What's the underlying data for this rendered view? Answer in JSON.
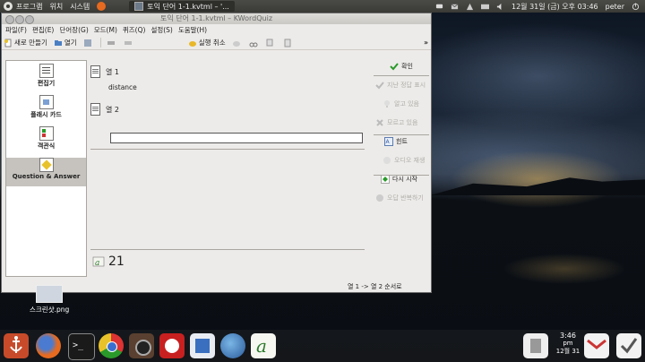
{
  "top_panel": {
    "menus": [
      "프로그램",
      "위치",
      "시스템"
    ],
    "task_title": "토익 단어 1-1.kvtml – '...",
    "clock": "12월 31일 (금) 오후 03:46",
    "user": "peter"
  },
  "window": {
    "title": "토익 단어 1-1.kvtml – KWordQuiz",
    "menus": [
      "파일(F)",
      "편집(E)",
      "단어장(G)",
      "모드(M)",
      "퀴즈(Q)",
      "설정(S)",
      "도움말(H)"
    ],
    "toolbar": {
      "new": "새로 만들기",
      "open": "열기",
      "undo": "실행 취소"
    },
    "sidebar": [
      "편집기",
      "플래시 카드",
      "객관식",
      "Question & Answer"
    ],
    "quiz": {
      "column1_label": "열 1",
      "question_text": "distance",
      "column2_label": "열 2",
      "answer_value": "",
      "remaining_count": "21"
    },
    "actions": {
      "check": "확인",
      "reveal_previous": "지난 정답 표시",
      "know": "알고 있음",
      "dont_know": "모르고 있음",
      "hint": "힌트",
      "audio": "오디오 재생",
      "restart": "다시 시작",
      "repeat_errors": "오답 반복하기"
    },
    "status": "열 1 -> 열 2 순서로"
  },
  "desktop": {
    "file_label": "스크린샷.png"
  },
  "dock": {
    "time": "3:46",
    "ampm": "pm",
    "date": "12월 31"
  },
  "colors": {
    "panel": "#3a3a36",
    "window_bg": "#edebe9",
    "active_mode": "#c6c3be",
    "check_green": "#2a9a2a"
  }
}
